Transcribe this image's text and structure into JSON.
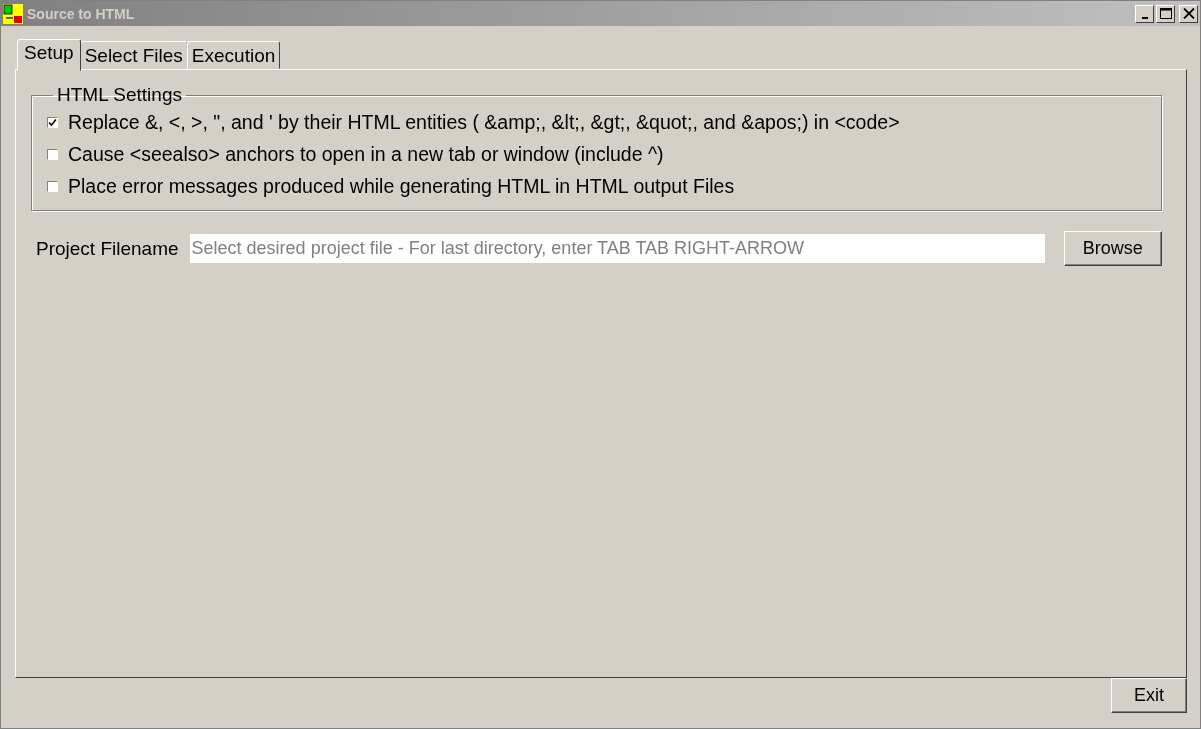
{
  "window": {
    "title": "Source to HTML"
  },
  "tabs": [
    {
      "label": "Setup",
      "selected": true
    },
    {
      "label": "Select Files",
      "selected": false
    },
    {
      "label": "Execution",
      "selected": false
    }
  ],
  "html_settings": {
    "title": "HTML Settings",
    "options": [
      {
        "label": "Replace &, <, >, \", and ' by their HTML entities ( &amp;, &lt;, &gt;, &quot;, and &apos;) in <code>",
        "checked": true
      },
      {
        "label": "Cause <seealso> anchors to open in a new tab or window (include ^)",
        "checked": false
      },
      {
        "label": "Place error messages produced while generating HTML in HTML output Files",
        "checked": false
      }
    ]
  },
  "project_filename": {
    "label": "Project Filename",
    "placeholder": "Select desired project file - For last directory, enter TAB TAB RIGHT-ARROW",
    "button": "Browse"
  },
  "exit_button": "Exit"
}
